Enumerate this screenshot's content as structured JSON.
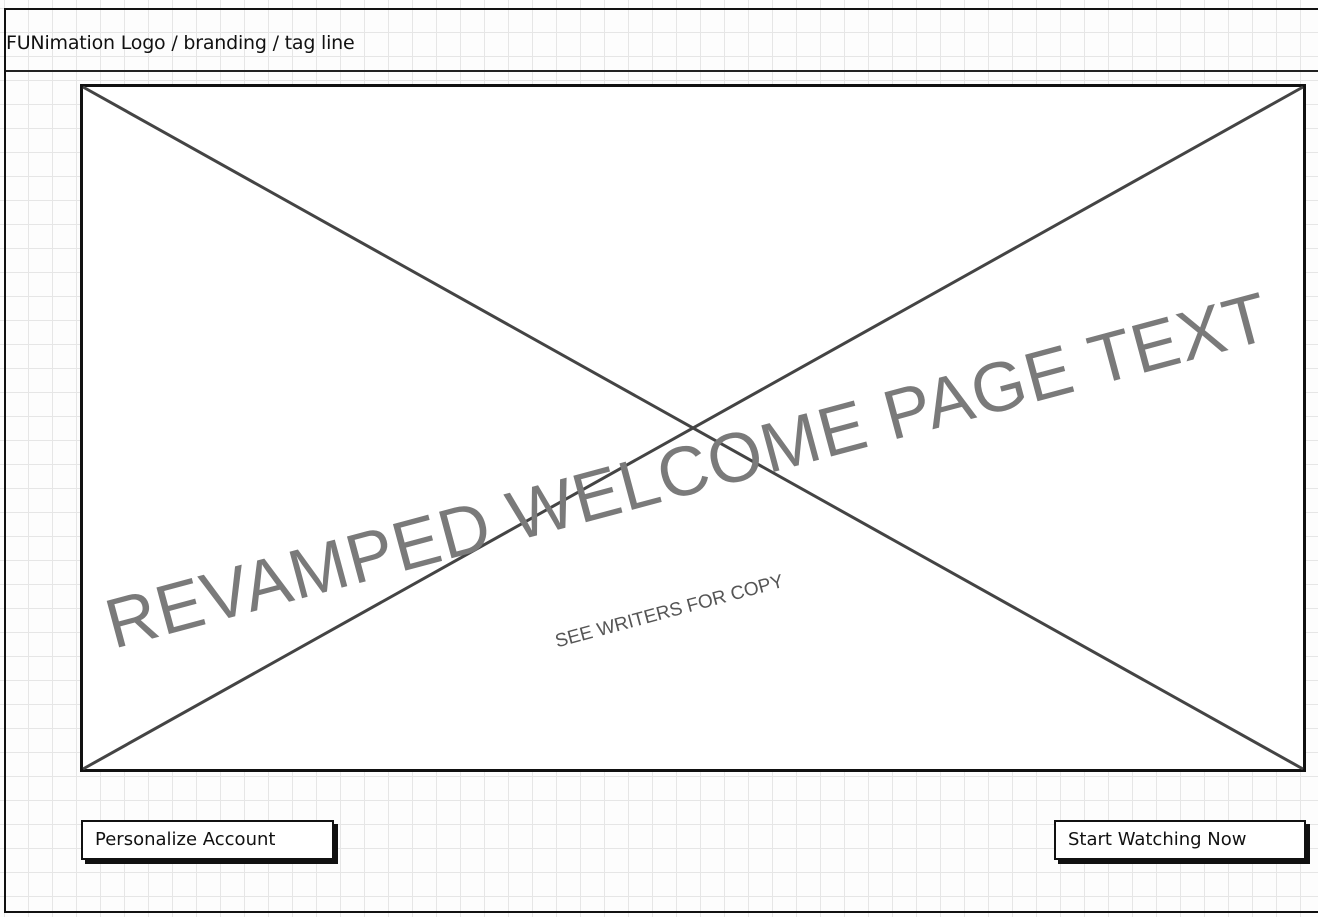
{
  "header": {
    "branding_text": "FUNimation Logo / branding / tag line"
  },
  "hero": {
    "placeholder": "image-placeholder",
    "headline": "REVAMPED WELCOME PAGE TEXT",
    "subtext": "SEE WRITERS FOR COPY"
  },
  "actions": {
    "personalize_label": "Personalize Account",
    "start_label": "Start Watching Now"
  }
}
